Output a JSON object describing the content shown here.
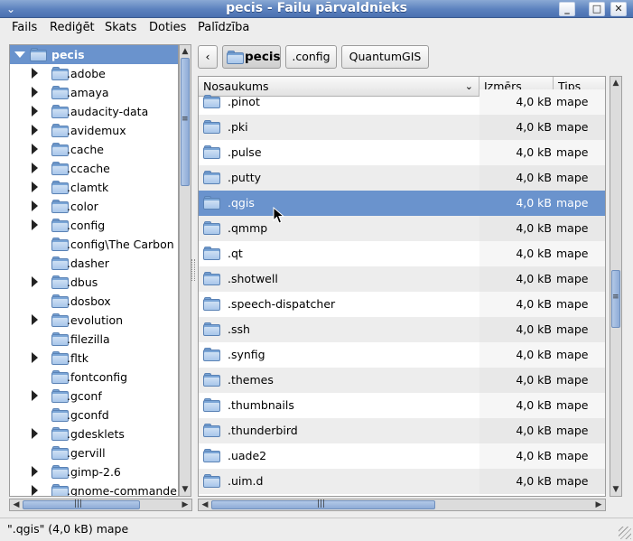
{
  "window": {
    "title": "pecis - Failu pārvaldnieks",
    "menu_glyph": "⌄",
    "minimize_glyph": "_",
    "maximize_glyph": "□",
    "close_glyph": "✕"
  },
  "menubar": {
    "items": [
      "Fails",
      "Rediģēt",
      "Skats",
      "Doties",
      "Palīdzība"
    ]
  },
  "tree": {
    "root": "pecis",
    "items": [
      {
        "label": ".adobe",
        "expandable": true
      },
      {
        "label": ".amaya",
        "expandable": true
      },
      {
        "label": ".audacity-data",
        "expandable": true
      },
      {
        "label": ".avidemux",
        "expandable": true
      },
      {
        "label": ".cache",
        "expandable": true
      },
      {
        "label": ".ccache",
        "expandable": true
      },
      {
        "label": ".clamtk",
        "expandable": true
      },
      {
        "label": ".color",
        "expandable": true
      },
      {
        "label": ".config",
        "expandable": true
      },
      {
        "label": ".config\\The Carbon",
        "expandable": false
      },
      {
        "label": ".dasher",
        "expandable": false
      },
      {
        "label": ".dbus",
        "expandable": true
      },
      {
        "label": ".dosbox",
        "expandable": false
      },
      {
        "label": ".evolution",
        "expandable": true
      },
      {
        "label": ".filezilla",
        "expandable": false
      },
      {
        "label": ".fltk",
        "expandable": true
      },
      {
        "label": ".fontconfig",
        "expandable": false
      },
      {
        "label": ".gconf",
        "expandable": true
      },
      {
        "label": ".gconfd",
        "expandable": false
      },
      {
        "label": ".gdesklets",
        "expandable": true
      },
      {
        "label": ".gervill",
        "expandable": false
      },
      {
        "label": ".gimp-2.6",
        "expandable": true
      },
      {
        "label": ".gnome-commande",
        "expandable": true
      }
    ]
  },
  "pathbar": {
    "back_glyph": "‹",
    "crumbs": [
      "pecis",
      ".config",
      "QuantumGIS"
    ]
  },
  "filelist": {
    "columns": [
      "Nosaukums",
      "Izmērs",
      "Tips"
    ],
    "sort_glyph": "⌄",
    "rows": [
      {
        "name": ".pinot",
        "size": "4,0 kB",
        "type": "mape"
      },
      {
        "name": ".pki",
        "size": "4,0 kB",
        "type": "mape"
      },
      {
        "name": ".pulse",
        "size": "4,0 kB",
        "type": "mape"
      },
      {
        "name": ".putty",
        "size": "4,0 kB",
        "type": "mape"
      },
      {
        "name": ".qgis",
        "size": "4,0 kB",
        "type": "mape",
        "selected": true
      },
      {
        "name": ".qmmp",
        "size": "4,0 kB",
        "type": "mape"
      },
      {
        "name": ".qt",
        "size": "4,0 kB",
        "type": "mape"
      },
      {
        "name": ".shotwell",
        "size": "4,0 kB",
        "type": "mape"
      },
      {
        "name": ".speech-dispatcher",
        "size": "4,0 kB",
        "type": "mape"
      },
      {
        "name": ".ssh",
        "size": "4,0 kB",
        "type": "mape"
      },
      {
        "name": ".synfig",
        "size": "4,0 kB",
        "type": "mape"
      },
      {
        "name": ".themes",
        "size": "4,0 kB",
        "type": "mape"
      },
      {
        "name": ".thumbnails",
        "size": "4,0 kB",
        "type": "mape"
      },
      {
        "name": ".thunderbird",
        "size": "4,0 kB",
        "type": "mape"
      },
      {
        "name": ".uade2",
        "size": "4,0 kB",
        "type": "mape"
      },
      {
        "name": ".uim.d",
        "size": "4,0 kB",
        "type": "mape"
      }
    ]
  },
  "scroll_glyphs": {
    "up": "▲",
    "down": "▼",
    "left": "◀",
    "right": "▶",
    "grip": "≡",
    "hgrip": "|||"
  },
  "statusbar": {
    "text": "\".qgis\" (4,0 kB) mape"
  },
  "colors": {
    "titlebar": "#5b81be",
    "selection": "#6a93cd",
    "folder": "#7aa5d6"
  }
}
